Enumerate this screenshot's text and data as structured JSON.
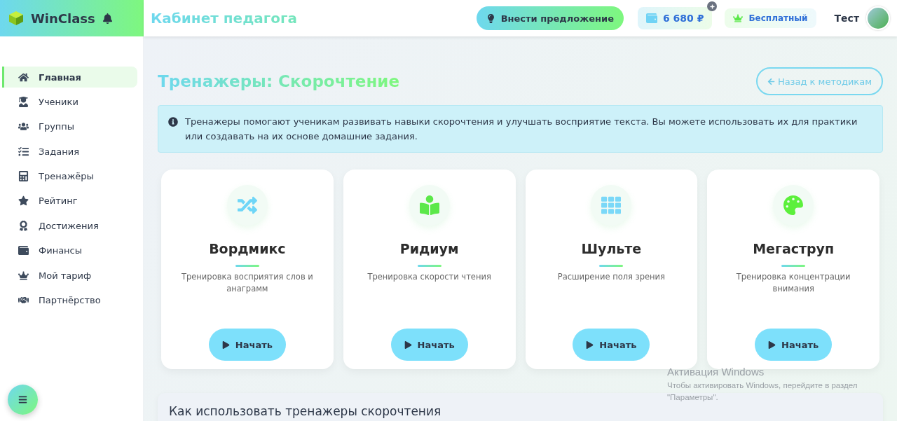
{
  "brand": {
    "name": "WinClass"
  },
  "header": {
    "title": "Кабинет педагога",
    "suggest_button": "Внести предложение",
    "balance": "6 680 ₽",
    "plan": "Бесплатный",
    "user": "Тест"
  },
  "sidebar": {
    "items": [
      {
        "label": "Главная",
        "selected": true
      },
      {
        "label": "Ученики",
        "selected": false
      },
      {
        "label": "Группы",
        "selected": false
      },
      {
        "label": "Задания",
        "selected": false
      },
      {
        "label": "Тренажёры",
        "selected": false
      },
      {
        "label": "Рейтинг",
        "selected": false
      },
      {
        "label": "Достижения",
        "selected": false
      },
      {
        "label": "Финансы",
        "selected": false
      },
      {
        "label": "Мой тариф",
        "selected": false
      },
      {
        "label": "Партнёрство",
        "selected": false
      }
    ]
  },
  "page": {
    "title": "Тренажеры: Скорочтение",
    "back_button": "Назад к методикам",
    "info": "Тренажеры помогают ученикам развивать навыки скорочтения и улучшать восприятие текста. Вы можете использовать их для практики или создавать на их основе домашние задания."
  },
  "cards": [
    {
      "title": "Вордмикс",
      "description": "Тренировка восприятия слов и анаграмм",
      "button": "Начать",
      "color": "#6fd6f7"
    },
    {
      "title": "Ридиум",
      "description": "Тренировка скорости чтения",
      "button": "Начать",
      "color": "#5ce84a"
    },
    {
      "title": "Шульте",
      "description": "Расширение поля зрения",
      "button": "Начать",
      "color": "#7ad8f8"
    },
    {
      "title": "Мегаструп",
      "description": "Тренировка концентрации внимания",
      "button": "Начать",
      "color": "#5cf03c"
    }
  ],
  "howto": {
    "title": "Как использовать тренажеры скорочтения"
  },
  "os_overlay": {
    "title": "Активация Windows",
    "text": "Чтобы активировать Windows, перейдите в раздел \"Параметры\"."
  }
}
